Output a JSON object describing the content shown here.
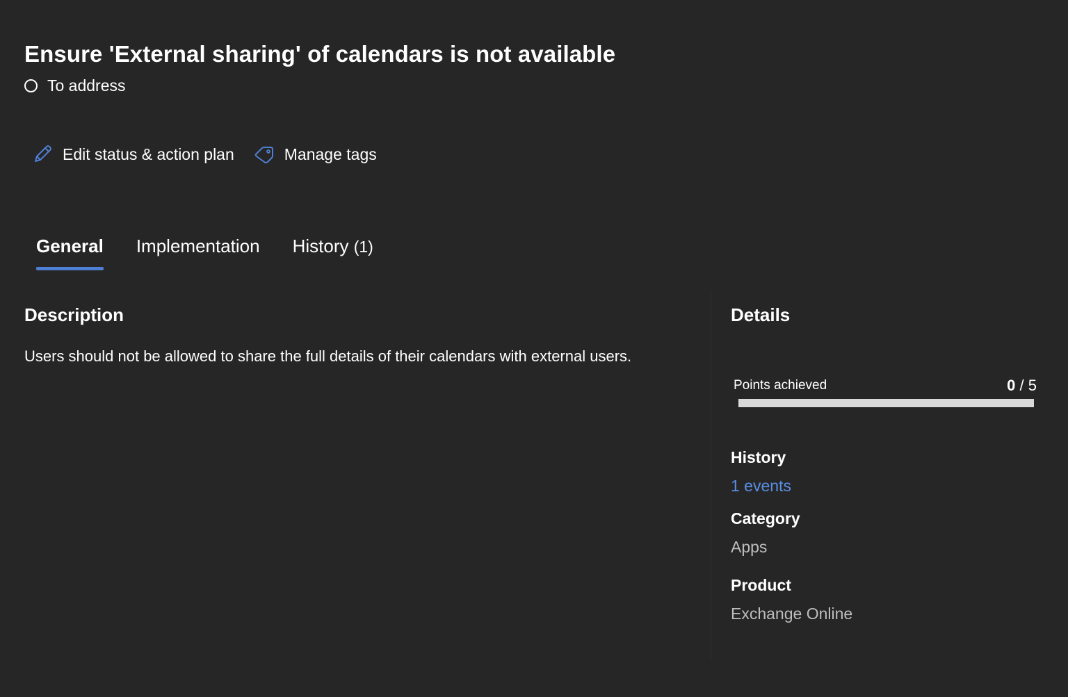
{
  "header": {
    "title": "Ensure 'External sharing' of calendars is not available",
    "status": "To address"
  },
  "actions": {
    "edit_label": "Edit status & action plan",
    "edit_icon": "pencil-icon",
    "tags_label": "Manage tags",
    "tags_icon": "tag-icon"
  },
  "tabs": [
    {
      "label": "General",
      "count": "",
      "active": true
    },
    {
      "label": "Implementation",
      "count": "",
      "active": false
    },
    {
      "label": "History",
      "count": "(1)",
      "active": false
    }
  ],
  "description": {
    "heading": "Description",
    "text": "Users should not be allowed to share the full details of their calendars with external users."
  },
  "details": {
    "heading": "Details",
    "points": {
      "label": "Points achieved",
      "achieved": "0",
      "separator": "/",
      "total": "5",
      "progress_fraction": 0
    },
    "history": {
      "label": "History",
      "value": "1 events"
    },
    "category": {
      "label": "Category",
      "value": "Apps"
    },
    "product": {
      "label": "Product",
      "value": "Exchange Online"
    }
  },
  "colors": {
    "background": "#262626",
    "accent": "#4f7fd4",
    "link": "#5a8fe6",
    "muted_text": "#bdbdbd",
    "progress_track": "#d9d9d9"
  }
}
